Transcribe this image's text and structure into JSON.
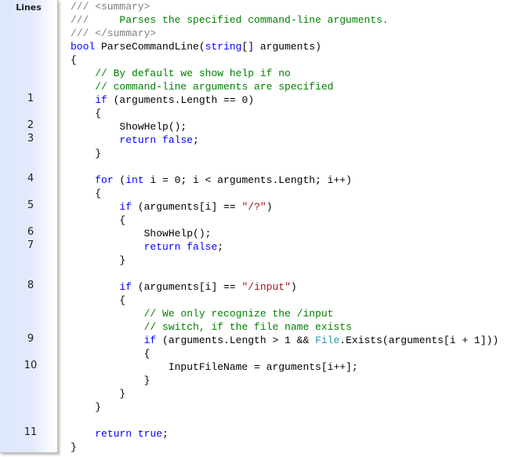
{
  "gutter": {
    "title": "Lines",
    "markers": [
      {
        "number": "1",
        "code_line": 7
      },
      {
        "number": "2",
        "code_line": 9
      },
      {
        "number": "3",
        "code_line": 10
      },
      {
        "number": "4",
        "code_line": 13
      },
      {
        "number": "5",
        "code_line": 15
      },
      {
        "number": "6",
        "code_line": 17
      },
      {
        "number": "7",
        "code_line": 18
      },
      {
        "number": "8",
        "code_line": 21
      },
      {
        "number": "9",
        "code_line": 25
      },
      {
        "number": "10",
        "code_line": 27
      },
      {
        "number": "11",
        "code_line": 32
      }
    ]
  },
  "colors": {
    "keyword": "#0000ff",
    "comment": "#008000",
    "doc_tag": "#808080",
    "string": "#a31515",
    "type": "#2b91af"
  },
  "code": [
    [
      {
        "t": "/// <summary>",
        "c": "doc"
      }
    ],
    [
      {
        "t": "///",
        "c": "doc"
      },
      {
        "t": "     Parses the specified command-line arguments.",
        "c": "cm"
      }
    ],
    [
      {
        "t": "/// </summary>",
        "c": "doc"
      }
    ],
    [
      {
        "t": "bool",
        "c": "kw"
      },
      {
        "t": " ParseCommandLine("
      },
      {
        "t": "string",
        "c": "kw"
      },
      {
        "t": "[] arguments)"
      }
    ],
    [
      {
        "t": "{"
      }
    ],
    [
      {
        "t": "    "
      },
      {
        "t": "// By default we show help if no",
        "c": "cm"
      }
    ],
    [
      {
        "t": "    "
      },
      {
        "t": "// command-line arguments are specified",
        "c": "cm"
      }
    ],
    [
      {
        "t": "    "
      },
      {
        "t": "if",
        "c": "kw"
      },
      {
        "t": " (arguments.Length == 0)"
      }
    ],
    [
      {
        "t": "    {"
      }
    ],
    [
      {
        "t": "        ShowHelp();"
      }
    ],
    [
      {
        "t": "        "
      },
      {
        "t": "return",
        "c": "kw"
      },
      {
        "t": " "
      },
      {
        "t": "false",
        "c": "kw"
      },
      {
        "t": ";"
      }
    ],
    [
      {
        "t": "    }"
      }
    ],
    [
      {
        "t": ""
      }
    ],
    [
      {
        "t": "    "
      },
      {
        "t": "for",
        "c": "kw"
      },
      {
        "t": " ("
      },
      {
        "t": "int",
        "c": "kw"
      },
      {
        "t": " i = 0; i < arguments.Length; i++)"
      }
    ],
    [
      {
        "t": "    {"
      }
    ],
    [
      {
        "t": "        "
      },
      {
        "t": "if",
        "c": "kw"
      },
      {
        "t": " (arguments[i] == "
      },
      {
        "t": "\"/?\"",
        "c": "str"
      },
      {
        "t": ")"
      }
    ],
    [
      {
        "t": "        {"
      }
    ],
    [
      {
        "t": "            ShowHelp();"
      }
    ],
    [
      {
        "t": "            "
      },
      {
        "t": "return",
        "c": "kw"
      },
      {
        "t": " "
      },
      {
        "t": "false",
        "c": "kw"
      },
      {
        "t": ";"
      }
    ],
    [
      {
        "t": "        }"
      }
    ],
    [
      {
        "t": ""
      }
    ],
    [
      {
        "t": "        "
      },
      {
        "t": "if",
        "c": "kw"
      },
      {
        "t": " (arguments[i] == "
      },
      {
        "t": "\"/input\"",
        "c": "str"
      },
      {
        "t": ")"
      }
    ],
    [
      {
        "t": "        {"
      }
    ],
    [
      {
        "t": "            "
      },
      {
        "t": "// We only recognize the /input",
        "c": "cm"
      }
    ],
    [
      {
        "t": "            "
      },
      {
        "t": "// switch, if the file name exists",
        "c": "cm"
      }
    ],
    [
      {
        "t": "            "
      },
      {
        "t": "if",
        "c": "kw"
      },
      {
        "t": " (arguments.Length > 1 && "
      },
      {
        "t": "File",
        "c": "type"
      },
      {
        "t": ".Exists(arguments[i + 1]))"
      }
    ],
    [
      {
        "t": "            {"
      }
    ],
    [
      {
        "t": "                InputFileName = arguments[i++];"
      }
    ],
    [
      {
        "t": "            }"
      }
    ],
    [
      {
        "t": "        }"
      }
    ],
    [
      {
        "t": "    }"
      }
    ],
    [
      {
        "t": ""
      }
    ],
    [
      {
        "t": "    "
      },
      {
        "t": "return",
        "c": "kw"
      },
      {
        "t": " "
      },
      {
        "t": "true",
        "c": "kw"
      },
      {
        "t": ";"
      }
    ],
    [
      {
        "t": "}"
      }
    ]
  ]
}
